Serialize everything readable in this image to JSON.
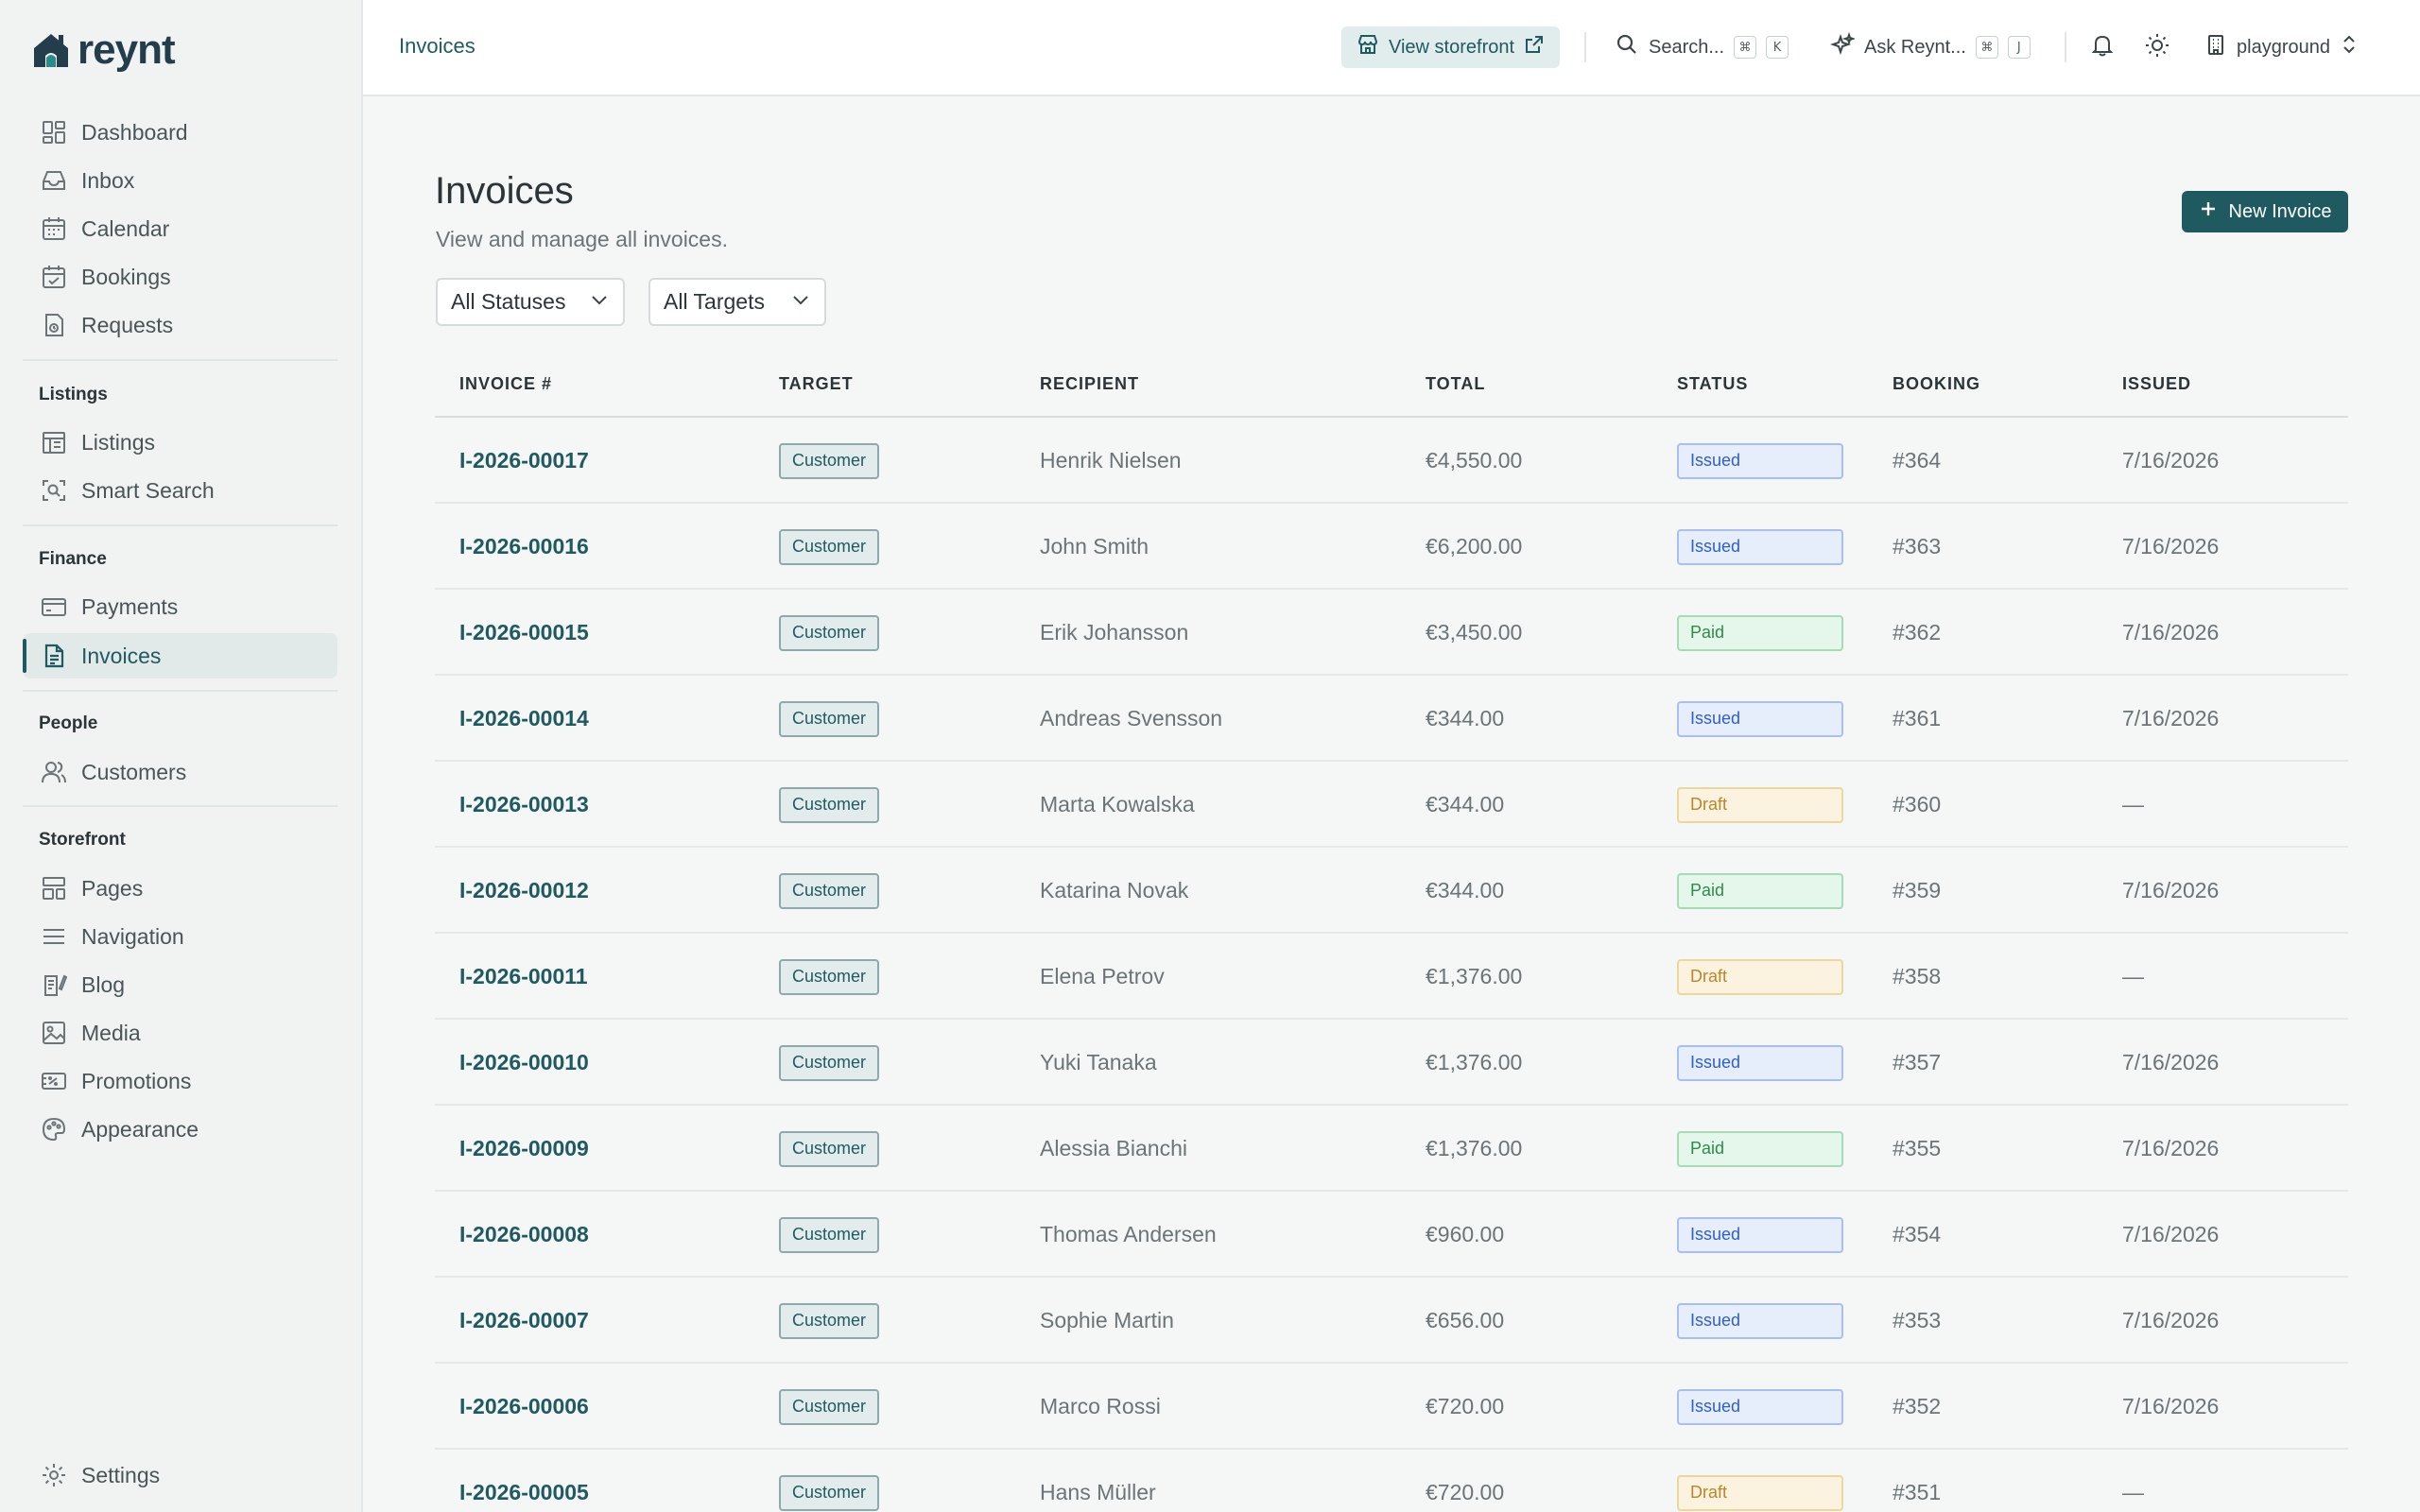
{
  "app": {
    "name": "reynt"
  },
  "sidebar": {
    "main": [
      {
        "label": "Dashboard",
        "icon": "dashboard-icon"
      },
      {
        "label": "Inbox",
        "icon": "inbox-icon"
      },
      {
        "label": "Calendar",
        "icon": "calendar-icon"
      },
      {
        "label": "Bookings",
        "icon": "bookings-icon"
      },
      {
        "label": "Requests",
        "icon": "requests-icon"
      }
    ],
    "listings_section": "Listings",
    "listings": [
      {
        "label": "Listings",
        "icon": "listings-icon"
      },
      {
        "label": "Smart Search",
        "icon": "smart-search-icon"
      }
    ],
    "finance_section": "Finance",
    "finance": [
      {
        "label": "Payments",
        "icon": "payments-icon"
      },
      {
        "label": "Invoices",
        "icon": "invoices-icon",
        "active": true
      }
    ],
    "people_section": "People",
    "people": [
      {
        "label": "Customers",
        "icon": "customers-icon"
      }
    ],
    "storefront_section": "Storefront",
    "storefront": [
      {
        "label": "Pages",
        "icon": "pages-icon"
      },
      {
        "label": "Navigation",
        "icon": "navigation-icon"
      },
      {
        "label": "Blog",
        "icon": "blog-icon"
      },
      {
        "label": "Media",
        "icon": "media-icon"
      },
      {
        "label": "Promotions",
        "icon": "promotions-icon"
      },
      {
        "label": "Appearance",
        "icon": "appearance-icon"
      }
    ],
    "settings": {
      "label": "Settings",
      "icon": "settings-icon"
    }
  },
  "topbar": {
    "breadcrumb": "Invoices",
    "view_storefront": "View storefront",
    "search": {
      "label": "Search...",
      "kbd1": "⌘",
      "kbd2": "K"
    },
    "ask": {
      "label": "Ask Reynt...",
      "kbd1": "⌘",
      "kbd2": "J"
    },
    "workspace": "playground"
  },
  "page": {
    "title": "Invoices",
    "subtitle": "View and manage all invoices.",
    "new_button": "New Invoice",
    "filter_status": "All Statuses",
    "filter_target": "All Targets"
  },
  "table": {
    "columns": [
      "INVOICE #",
      "TARGET",
      "RECIPIENT",
      "TOTAL",
      "STATUS",
      "BOOKING",
      "ISSUED"
    ],
    "rows": [
      {
        "invoice": "I-2026-00017",
        "target": "Customer",
        "recipient": "Henrik Nielsen",
        "total": "€4,550.00",
        "status": "Issued",
        "booking": "#364",
        "issued": "7/16/2026"
      },
      {
        "invoice": "I-2026-00016",
        "target": "Customer",
        "recipient": "John Smith",
        "total": "€6,200.00",
        "status": "Issued",
        "booking": "#363",
        "issued": "7/16/2026"
      },
      {
        "invoice": "I-2026-00015",
        "target": "Customer",
        "recipient": "Erik Johansson",
        "total": "€3,450.00",
        "status": "Paid",
        "booking": "#362",
        "issued": "7/16/2026"
      },
      {
        "invoice": "I-2026-00014",
        "target": "Customer",
        "recipient": "Andreas Svensson",
        "total": "€344.00",
        "status": "Issued",
        "booking": "#361",
        "issued": "7/16/2026"
      },
      {
        "invoice": "I-2026-00013",
        "target": "Customer",
        "recipient": "Marta Kowalska",
        "total": "€344.00",
        "status": "Draft",
        "booking": "#360",
        "issued": "—"
      },
      {
        "invoice": "I-2026-00012",
        "target": "Customer",
        "recipient": "Katarina Novak",
        "total": "€344.00",
        "status": "Paid",
        "booking": "#359",
        "issued": "7/16/2026"
      },
      {
        "invoice": "I-2026-00011",
        "target": "Customer",
        "recipient": "Elena Petrov",
        "total": "€1,376.00",
        "status": "Draft",
        "booking": "#358",
        "issued": "—"
      },
      {
        "invoice": "I-2026-00010",
        "target": "Customer",
        "recipient": "Yuki Tanaka",
        "total": "€1,376.00",
        "status": "Issued",
        "booking": "#357",
        "issued": "7/16/2026"
      },
      {
        "invoice": "I-2026-00009",
        "target": "Customer",
        "recipient": "Alessia Bianchi",
        "total": "€1,376.00",
        "status": "Paid",
        "booking": "#355",
        "issued": "7/16/2026"
      },
      {
        "invoice": "I-2026-00008",
        "target": "Customer",
        "recipient": "Thomas Andersen",
        "total": "€960.00",
        "status": "Issued",
        "booking": "#354",
        "issued": "7/16/2026"
      },
      {
        "invoice": "I-2026-00007",
        "target": "Customer",
        "recipient": "Sophie Martin",
        "total": "€656.00",
        "status": "Issued",
        "booking": "#353",
        "issued": "7/16/2026"
      },
      {
        "invoice": "I-2026-00006",
        "target": "Customer",
        "recipient": "Marco Rossi",
        "total": "€720.00",
        "status": "Issued",
        "booking": "#352",
        "issued": "7/16/2026"
      },
      {
        "invoice": "I-2026-00005",
        "target": "Customer",
        "recipient": "Hans Müller",
        "total": "€720.00",
        "status": "Draft",
        "booking": "#351",
        "issued": "—"
      }
    ]
  },
  "colors": {
    "brand": "#1f5a60",
    "issued": "#2f5fc4",
    "paid": "#2e8c4b",
    "draft": "#b8872a"
  }
}
